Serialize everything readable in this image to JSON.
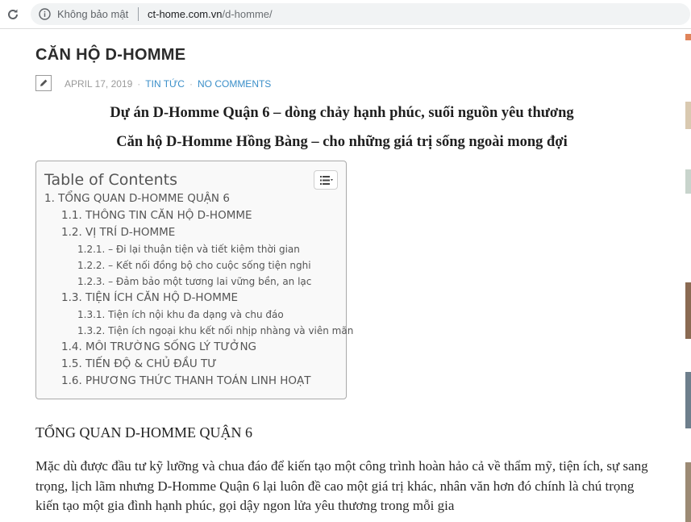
{
  "browser": {
    "security_label": "Không bảo mật",
    "url_domain": "ct-home.com.vn",
    "url_path": "/d-homme/"
  },
  "post": {
    "title": "CĂN HỘ D-HOMME",
    "date": "APRIL 17, 2019",
    "category": "TIN TỨC",
    "comments": "NO COMMENTS",
    "intro_line_1": "Dự án D-Homme Quận 6 – dòng chảy hạnh phúc, suối nguồn yêu thương",
    "intro_line_2": "Căn hộ D-Homme Hồng Bàng – cho những giá trị sống ngoài mong đợi"
  },
  "toc": {
    "title": "Table of Contents",
    "items": [
      {
        "label": "1. TỔNG QUAN D-HOMME QUẬN 6"
      },
      {
        "label": "1.1. THÔNG TIN CĂN HỘ D-HOMME"
      },
      {
        "label": "1.2. VỊ TRÍ D-HOMME"
      },
      {
        "label": "1.2.1. – Đi lại thuận tiện và tiết kiệm thời gian"
      },
      {
        "label": "1.2.2. – Kết nối đồng bộ cho cuộc sống tiện nghi"
      },
      {
        "label": "1.2.3. – Đảm bảo một tương lai vững bền, an lạc"
      },
      {
        "label": "1.3. TIỆN ÍCH CĂN HỘ D-HOMME"
      },
      {
        "label": "1.3.1. Tiện ích nội khu  đa dạng và chu đáo"
      },
      {
        "label": "1.3.2. Tiện ích ngoại khu kết nối nhịp nhàng và viên mãn"
      },
      {
        "label": "1.4. MÔI TRƯỜNG SỐNG LÝ TƯỞNG"
      },
      {
        "label": "1.5. TIẾN ĐỘ  & CHỦ ĐẦU TƯ"
      },
      {
        "label": "1.6. PHƯƠNG THỨC THANH TOÁN LINH HOẠT"
      }
    ]
  },
  "content": {
    "section_heading": "TỔNG QUAN D-HOMME QUẬN 6",
    "paragraph": "Mặc dù được đầu tư kỹ lưỡng và chua đáo để kiến tạo một công trình hoàn hảo cả về thẩm mỹ, tiện ích, sự sang trọng, lịch lãm nhưng D-Homme Quận 6  lại luôn đề cao một giá trị khác, nhân văn hơn đó chính là chú trọng kiến tạo một gia đình hạnh phúc, gọi dậy ngon lửa yêu thương trong mỗi gia"
  },
  "colors": {
    "link": "#3b8fc9",
    "toc_background": "#f9f9f9",
    "toc_border": "#aaaaaa",
    "meta_gray": "#9a9a9a"
  },
  "icons": {
    "reload": "reload-icon",
    "info": "info-icon",
    "edit": "pencil-icon",
    "toc_toggle": "list-icon"
  }
}
